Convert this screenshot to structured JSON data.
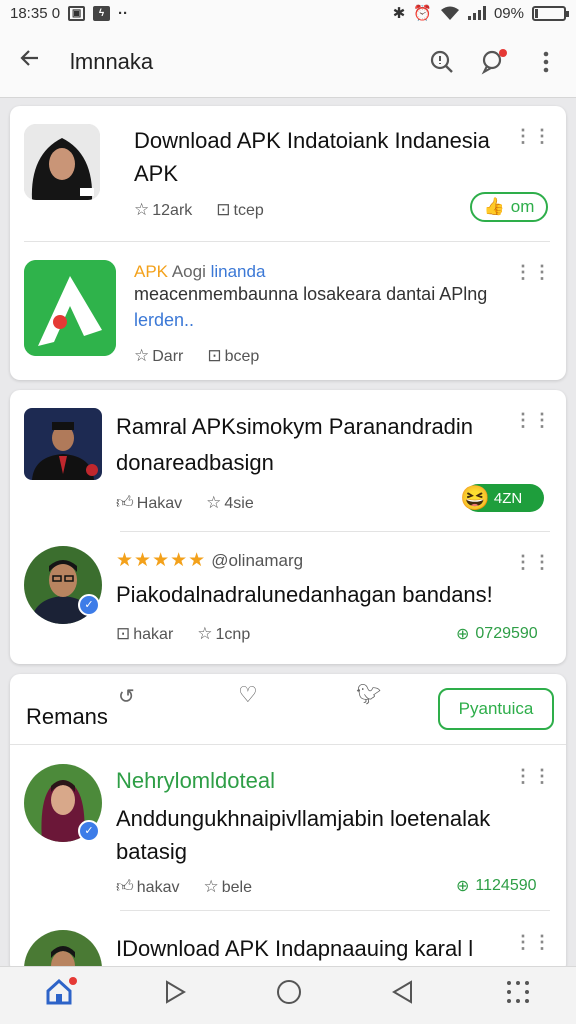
{
  "status": {
    "time": "18:35 0",
    "battery": "09%",
    "battery_level": 0.09
  },
  "appbar": {
    "title": "Ɩmnnaka"
  },
  "card1": {
    "item1": {
      "title": "Download APK Indatoiank Indanesia APK",
      "meta1": "12ark",
      "meta2": "tcep",
      "pill": "om"
    },
    "item2": {
      "brand1": "APK",
      "brand2": "Aogi",
      "brand3": "linanda",
      "line1": "meacenmembaunna losakeara dantai APlng",
      "line2": "lerden..",
      "meta1": "Darr",
      "meta2": "bcep"
    }
  },
  "card2": {
    "item1": {
      "title": "Ramral APKsimokym Paranandradin",
      "subtitle": "donareadbasign",
      "meta1": "Hakav",
      "meta2": "4sie",
      "badge": "4ZN"
    },
    "item2": {
      "stars": "★★★★★",
      "handle": "@olinamarg",
      "text": "Piakodalnadralunedanhagan bandans!",
      "meta1": "hakar",
      "meta2": "1cnp",
      "count": "0729590"
    }
  },
  "card3": {
    "header": {
      "label": "Remans",
      "button": "Pyantuica"
    },
    "item1": {
      "name": "Nehrylomldoteal",
      "text": "Anddungukhnaipivllamjabin loetenalak batasig",
      "meta1": "hakav",
      "meta2": "bele",
      "count": "1124590"
    },
    "item2": {
      "title": "IDownload APK Indapnaauing karal l"
    }
  }
}
